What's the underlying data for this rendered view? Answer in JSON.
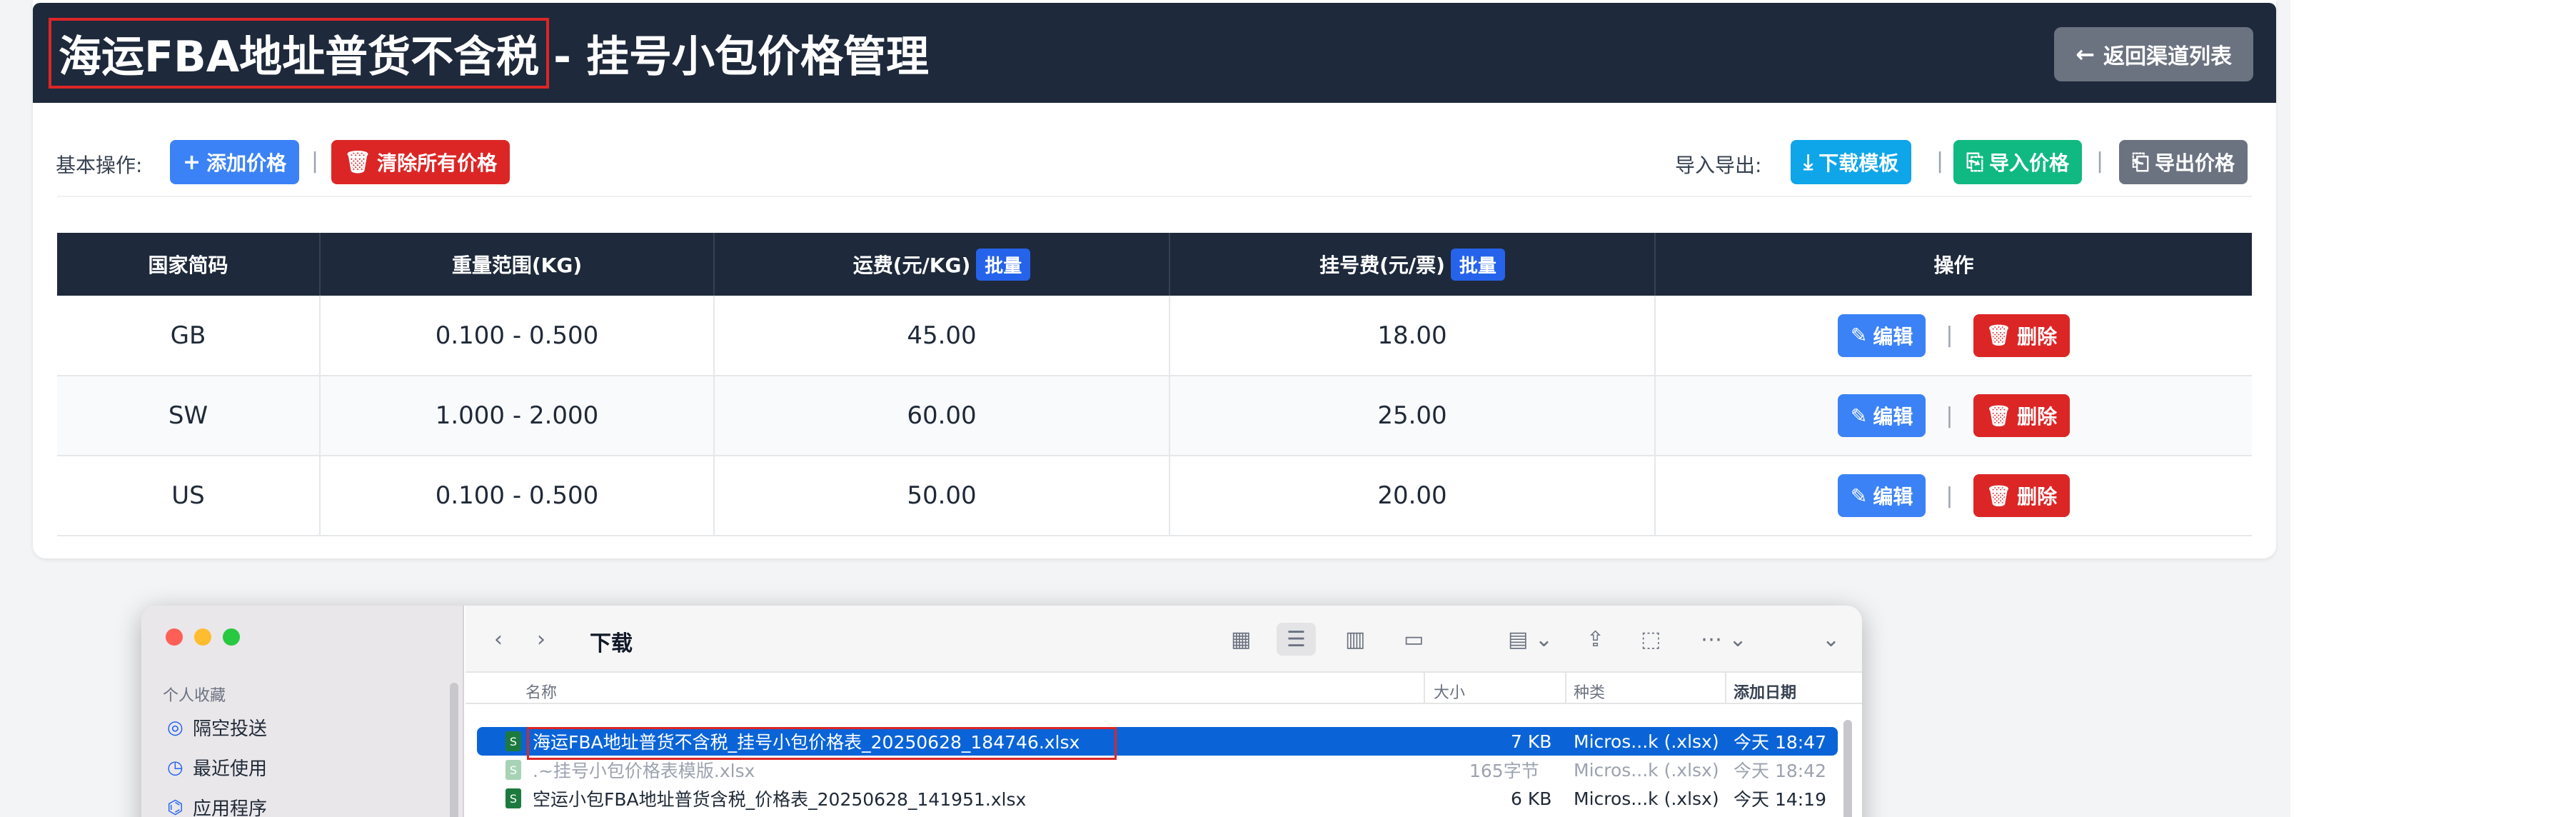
{
  "header": {
    "title_highlight": "海运FBA地址普货不含税",
    "title_rest": "- 挂号小包价格管理",
    "back_label": "返回渠道列表"
  },
  "ops": {
    "basic_label": "基本操作:",
    "add_label": "添加价格",
    "clear_label": "清除所有价格",
    "io_label": "导入导出:",
    "download_label": "下载模板",
    "import_label": "导入价格",
    "export_label": "导出价格"
  },
  "table": {
    "headers": {
      "country": "国家简码",
      "weight": "重量范围(KG)",
      "freight": "运费(元/KG)",
      "reg_fee": "挂号费(元/票)",
      "action": "操作"
    },
    "batch_label": "批量",
    "rows": [
      {
        "country": "GB",
        "weight": "0.100 - 0.500",
        "freight": "45.00",
        "reg_fee": "18.00"
      },
      {
        "country": "SW",
        "weight": "1.000 - 2.000",
        "freight": "60.00",
        "reg_fee": "25.00"
      },
      {
        "country": "US",
        "weight": "0.100 - 0.500",
        "freight": "50.00",
        "reg_fee": "20.00"
      }
    ],
    "edit_label": "编辑",
    "delete_label": "删除"
  },
  "finder": {
    "title": "下载",
    "sidebar_header": "个人收藏",
    "sidebar_items": [
      "隔空投送",
      "最近使用",
      "应用程序"
    ],
    "columns": {
      "name": "名称",
      "size": "大小",
      "kind": "种类",
      "date": "添加日期"
    },
    "files": [
      {
        "name": "海运FBA地址普货不含税_挂号小包价格表_20250628_184746.xlsx",
        "size": "7 KB",
        "kind": "Micros...k (.xlsx)",
        "date": "今天 18:47"
      },
      {
        "name": ".~挂号小包价格表模版.xlsx",
        "size": "165字节",
        "kind": "Micros...k (.xlsx)",
        "date": "今天 18:42"
      },
      {
        "name": "空运小包FBA地址普货含税_价格表_20250628_141951.xlsx",
        "size": "6 KB",
        "kind": "Micros...k (.xlsx)",
        "date": "今天 14:19"
      }
    ]
  },
  "colors": {
    "header_bg": "#1e293b",
    "primary": "#3b82f6",
    "danger": "#dc2626",
    "info": "#0ea5e9",
    "success": "#10b981",
    "secondary": "#6b7280",
    "finder_selection": "#0a64d8"
  },
  "icons": {
    "back": "arrow-left-icon",
    "add": "plus-icon",
    "clear": "trash-icon",
    "download": "download-icon",
    "import": "file-import-icon",
    "export": "file-export-icon",
    "edit": "edit-icon",
    "delete": "trash-icon"
  }
}
